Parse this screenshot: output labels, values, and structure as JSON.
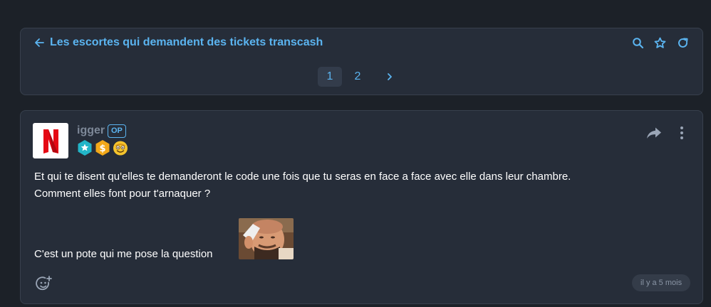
{
  "topic": {
    "title": "Les escortes qui demandent des tickets transcash",
    "icons": [
      "arrow-left-icon",
      "search-icon",
      "star-icon",
      "refresh-icon"
    ]
  },
  "pagination": {
    "pages": [
      "1",
      "2"
    ],
    "current": "1",
    "next_icon": "chevron-right-icon"
  },
  "post": {
    "author": "igger",
    "op_label": "OP",
    "avatar_letter": "N",
    "badge_icons": [
      "star-hexagon-badge",
      "dollar-coin-badge",
      "smiley-badge"
    ],
    "lines": [
      "Et qui te disent qu'elles te demanderont le code une fois que tu seras en face a face avec elle dans leur chambre.",
      "Comment elles font pour t'arnaquer ?",
      "C'est un pote qui me pose la question"
    ],
    "timestamp": "il y a 5 mois",
    "action_icons": [
      "share-icon",
      "more-vertical-icon",
      "add-reaction-icon"
    ]
  },
  "colors": {
    "background": "#1c2128",
    "card": "#262d39",
    "accent": "#5bb4f0",
    "muted": "#7d8898"
  }
}
